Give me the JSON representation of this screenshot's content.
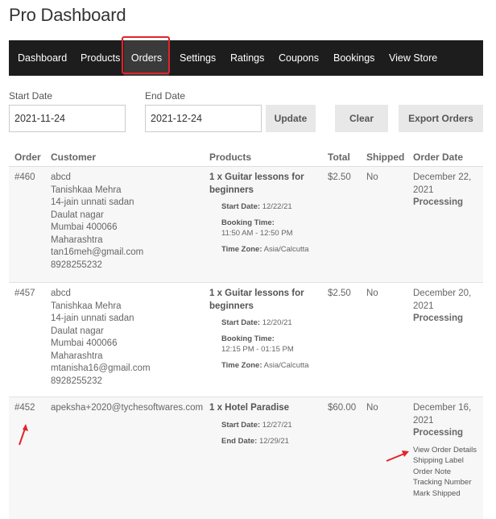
{
  "page": {
    "title": "Pro Dashboard"
  },
  "nav": {
    "items": [
      "Dashboard",
      "Products",
      "Orders",
      "Settings",
      "Ratings",
      "Coupons",
      "Bookings",
      "View Store"
    ],
    "active": "Orders"
  },
  "filters": {
    "start_label": "Start Date",
    "start_value": "2021-11-24",
    "end_label": "End Date",
    "end_value": "2021-12-24",
    "update_label": "Update",
    "clear_label": "Clear",
    "export_label": "Export Orders"
  },
  "table": {
    "headers": [
      "Order",
      "Customer",
      "Products",
      "Total",
      "Shipped",
      "Order Date"
    ],
    "rows": [
      {
        "order": "#460",
        "customer": [
          "abcd",
          "Tanishkaa Mehra",
          "14-jain unnati sadan",
          "Daulat nagar",
          "Mumbai 400066",
          "Maharashtra",
          "tan16meh@gmail.com",
          "8928255232"
        ],
        "product_title": "1 x Guitar lessons for beginners",
        "meta": [
          {
            "label": "Start Date:",
            "value": "12/22/21"
          },
          {
            "label": "Booking Time:",
            "value": "11:50 AM - 12:50 PM"
          },
          {
            "label": "Time Zone:",
            "value": "Asia/Calcutta"
          }
        ],
        "total": "$2.50",
        "shipped": "No",
        "date": "December 22, 2021",
        "status": "Processing"
      },
      {
        "order": "#457",
        "customer": [
          "abcd",
          "Tanishkaa Mehra",
          "14-jain unnati sadan",
          "Daulat nagar",
          "Mumbai 400066",
          "Maharashtra",
          "mtanisha16@gmail.com",
          "8928255232"
        ],
        "product_title": "1 x Guitar lessons for beginners",
        "meta": [
          {
            "label": "Start Date:",
            "value": "12/20/21"
          },
          {
            "label": "Booking Time:",
            "value": "12:15 PM - 01:15 PM"
          },
          {
            "label": "Time Zone:",
            "value": "Asia/Calcutta"
          }
        ],
        "total": "$2.50",
        "shipped": "No",
        "date": "December 20, 2021",
        "status": "Processing"
      },
      {
        "order": "#452",
        "customer": [
          "apeksha+2020@tychesoftwares.com"
        ],
        "product_title": "1 x Hotel Paradise",
        "meta": [
          {
            "label": "Start Date:",
            "value": "12/27/21"
          },
          {
            "label": "End Date:",
            "value": "12/29/21"
          }
        ],
        "total": "$60.00",
        "shipped": "No",
        "date": "December 16, 2021",
        "status": "Processing",
        "actions": [
          "View Order Details",
          "Shipping Label",
          "Order Note",
          "Tracking Number",
          "Mark Shipped"
        ]
      }
    ]
  },
  "colors": {
    "nav_bg": "#1d1d1d",
    "nav_active_bg": "#3a3a3a",
    "annotation": "#e3232b",
    "row_alt_bg": "#f7f7f7"
  }
}
